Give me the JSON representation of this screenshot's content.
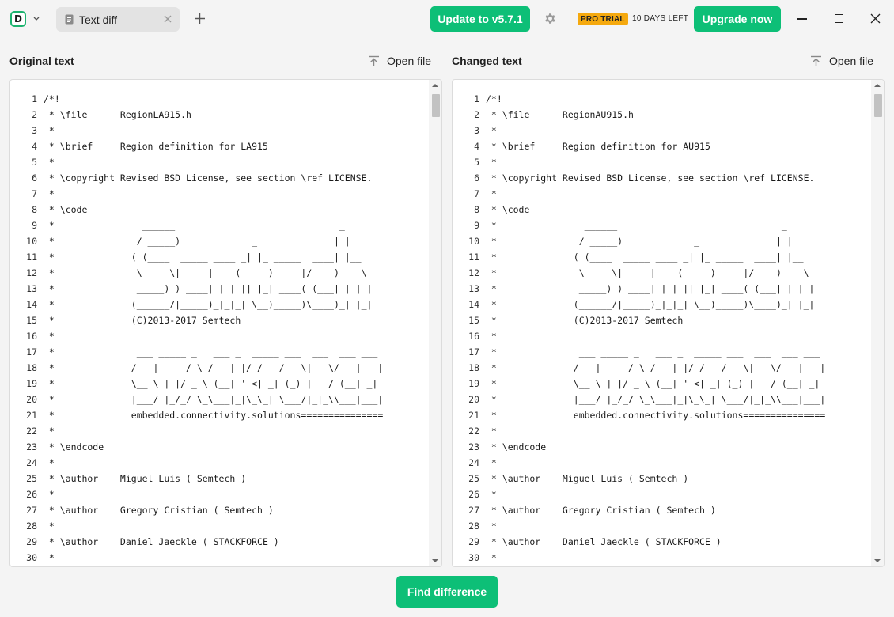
{
  "app": {
    "logo_letter": "D",
    "tab_label": "Text diff",
    "update_label": "Update to v5.7.1",
    "pro_badge": "PRO TRIAL",
    "days_left": "10 DAYS LEFT",
    "upgrade_label": "Upgrade now",
    "accent": "#0dbf77"
  },
  "left": {
    "title": "Original text",
    "open_file": "Open file",
    "lines": [
      "/*!",
      " * \\file      RegionLA915.h",
      " *",
      " * \\brief     Region definition for LA915",
      " *",
      " * \\copyright Revised BSD License, see section \\ref LICENSE.",
      " *",
      " * \\code",
      " *                ______                              _",
      " *               / _____)             _              | |",
      " *              ( (____  _____ ____ _| |_ _____  ____| |__",
      " *               \\____ \\| ___ |    (_   _) ___ |/ ___)  _ \\",
      " *               _____) ) ____| | | || |_| ____( (___| | | |",
      " *              (______/|_____)_|_|_| \\__)_____)\\____)_| |_|",
      " *              (C)2013-2017 Semtech",
      " *",
      " *               ___ _____ _   ___ _  _____ ___  ___  ___ ___",
      " *              / __|_   _/_\\ / __| |/ / __/ _ \\| _ \\/ __| __|",
      " *              \\__ \\ | |/ _ \\ (__| ' <| _| (_) |   / (__| _|",
      " *              |___/ |_/_/ \\_\\___|_|\\_\\_| \\___/|_|_\\\\___|___|",
      " *              embedded.connectivity.solutions===============",
      " *",
      " * \\endcode",
      " *",
      " * \\author    Miguel Luis ( Semtech )",
      " *",
      " * \\author    Gregory Cristian ( Semtech )",
      " *",
      " * \\author    Daniel Jaeckle ( STACKFORCE )",
      " *"
    ]
  },
  "right": {
    "title": "Changed text",
    "open_file": "Open file",
    "lines": [
      "/*!",
      " * \\file      RegionAU915.h",
      " *",
      " * \\brief     Region definition for AU915",
      " *",
      " * \\copyright Revised BSD License, see section \\ref LICENSE.",
      " *",
      " * \\code",
      " *                ______                              _",
      " *               / _____)             _              | |",
      " *              ( (____  _____ ____ _| |_ _____  ____| |__",
      " *               \\____ \\| ___ |    (_   _) ___ |/ ___)  _ \\",
      " *               _____) ) ____| | | || |_| ____( (___| | | |",
      " *              (______/|_____)_|_|_| \\__)_____)\\____)_| |_|",
      " *              (C)2013-2017 Semtech",
      " *",
      " *               ___ _____ _   ___ _  _____ ___  ___  ___ ___",
      " *              / __|_   _/_\\ / __| |/ / __/ _ \\| _ \\/ __| __|",
      " *              \\__ \\ | |/ _ \\ (__| ' <| _| (_) |   / (__| _|",
      " *              |___/ |_/_/ \\_\\___|_|\\_\\_| \\___/|_|_\\\\___|___|",
      " *              embedded.connectivity.solutions===============",
      " *",
      " * \\endcode",
      " *",
      " * \\author    Miguel Luis ( Semtech )",
      " *",
      " * \\author    Gregory Cristian ( Semtech )",
      " *",
      " * \\author    Daniel Jaeckle ( STACKFORCE )",
      " *"
    ]
  },
  "find_label": "Find difference"
}
